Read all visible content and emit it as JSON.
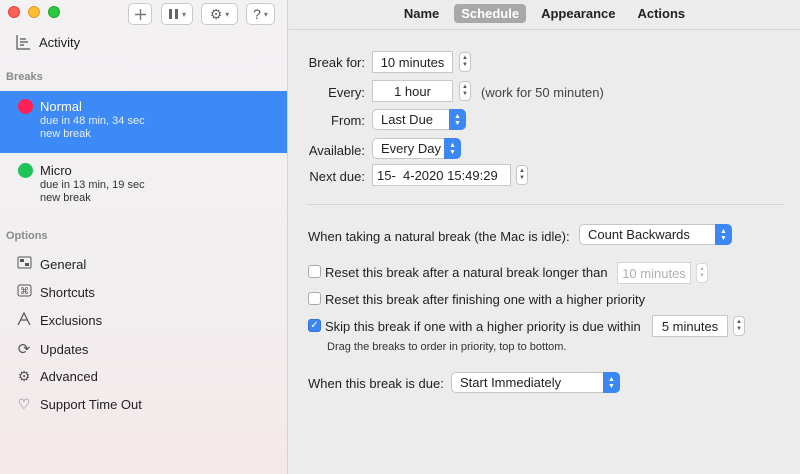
{
  "toolbar": {
    "add_icon": "plus-icon",
    "pause_icon": "pause-icon",
    "gear_icon": "gear-icon",
    "help_label": "?"
  },
  "sidebar": {
    "activity_label": "Activity",
    "breaks_header": "Breaks",
    "breaks": [
      {
        "name": "Normal",
        "due": "due in 48 min, 34 sec",
        "kind": "new break",
        "color": "#ff2056",
        "selected": true
      },
      {
        "name": "Micro",
        "due": "due in 13 min, 19 sec",
        "kind": "new break",
        "color": "#1ec35a",
        "selected": false
      }
    ],
    "options_header": "Options",
    "options": [
      {
        "label": "General",
        "icon": "general-icon"
      },
      {
        "label": "Shortcuts",
        "icon": "shortcuts-icon"
      },
      {
        "label": "Exclusions",
        "icon": "exclusions-icon"
      },
      {
        "label": "Updates",
        "icon": "updates-icon"
      },
      {
        "label": "Advanced",
        "icon": "advanced-gear-icon"
      },
      {
        "label": "Support Time Out",
        "icon": "heart-icon"
      }
    ]
  },
  "tabs": [
    {
      "label": "Name",
      "active": false
    },
    {
      "label": "Schedule",
      "active": true
    },
    {
      "label": "Appearance",
      "active": false
    },
    {
      "label": "Actions",
      "active": false
    }
  ],
  "schedule": {
    "break_for_label": "Break for:",
    "break_for_value": "10 minutes",
    "every_label": "Every:",
    "every_value": "1 hour",
    "every_note": "(work for 50 minuten)",
    "from_label": "From:",
    "from_value": "Last Due",
    "available_label": "Available:",
    "available_value": "Every Day",
    "next_due_label": "Next due:",
    "next_due_value": "15-  4-2020 15:49:29",
    "natural_label": "When taking a natural break (the Mac is idle):",
    "natural_value": "Count Backwards",
    "reset_natural_label": "Reset this break after a natural break longer than",
    "reset_natural_value": "10 minutes",
    "reset_natural_checked": false,
    "reset_higher_label": "Reset this break after finishing one with a higher priority",
    "reset_higher_checked": false,
    "skip_label": "Skip this break if one with a higher priority is due within",
    "skip_value": "5 minutes",
    "skip_checked": true,
    "drag_note": "Drag the breaks to order in priority, top to bottom.",
    "when_due_label": "When this break is due:",
    "when_due_value": "Start Immediately"
  },
  "colors": {
    "accent": "#3b87f4",
    "selection": "#3d89f5"
  }
}
